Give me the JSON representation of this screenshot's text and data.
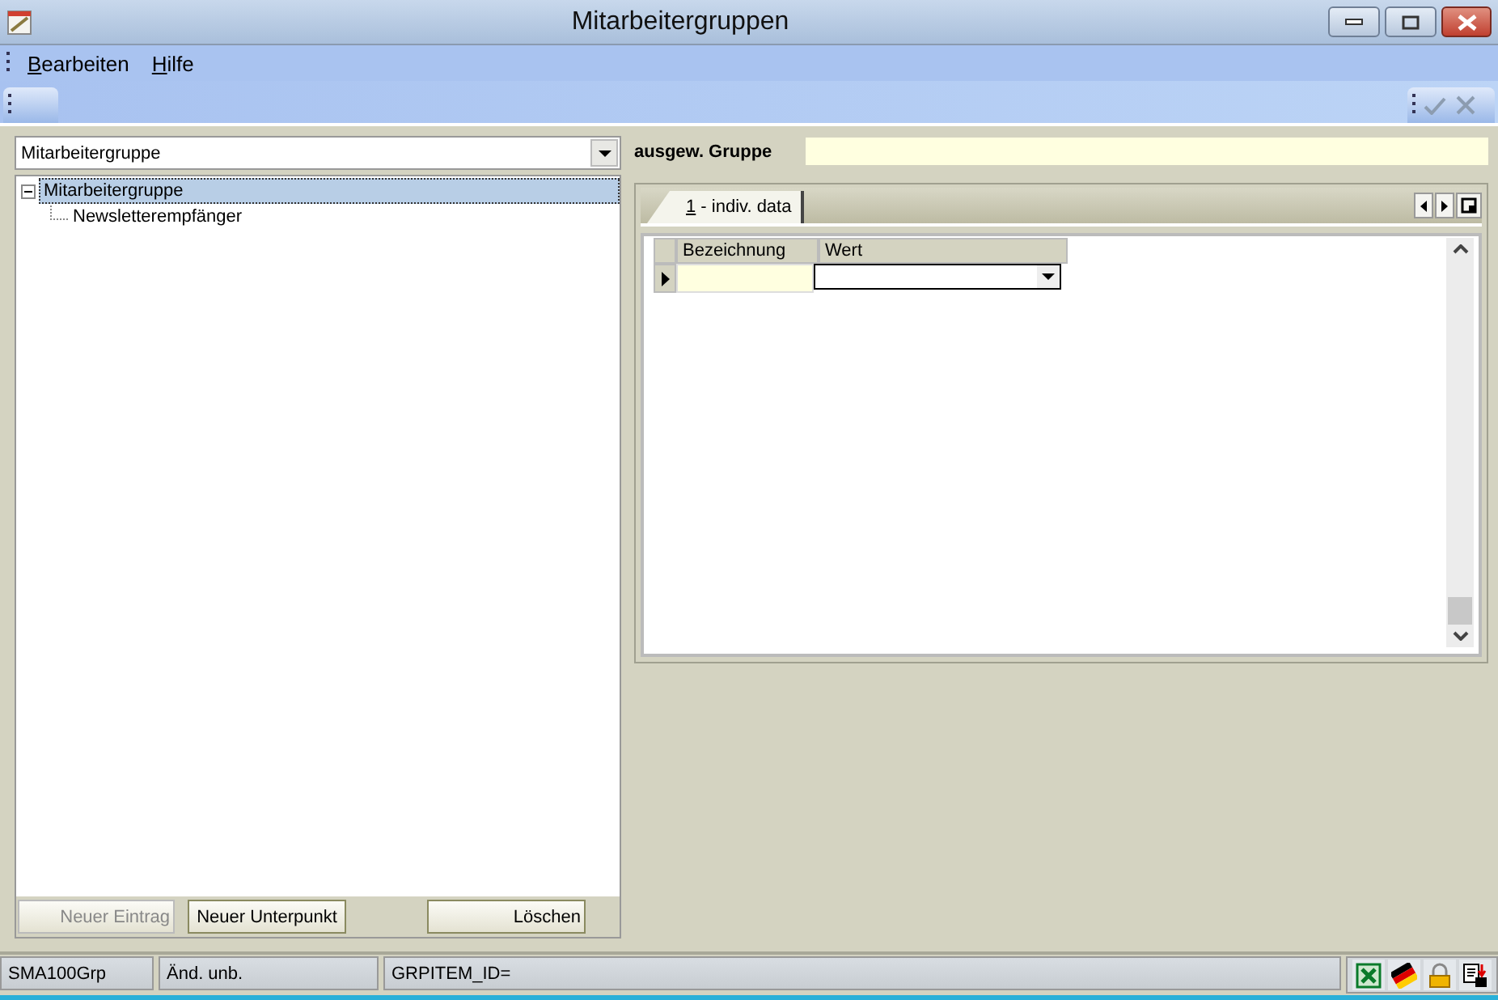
{
  "window": {
    "title": "Mitarbeitergruppen"
  },
  "menu": [
    {
      "label": "Bearbeiten",
      "underlined_initial": true
    },
    {
      "label": "Hilfe",
      "underlined_initial": true
    }
  ],
  "toolbar_right": {
    "confirm_disabled": true,
    "cancel_disabled": true
  },
  "group_select": {
    "value": "Mitarbeitergruppe"
  },
  "tree": [
    {
      "label": "Mitarbeitergruppe",
      "selected": true,
      "expanded": true,
      "children": [
        {
          "label": "Newsletterempfänger",
          "selected": false
        }
      ]
    }
  ],
  "tree_buttons": [
    {
      "label": "Neuer Eintrag",
      "disabled": true
    },
    {
      "label": "Neuer Unterpunkt",
      "disabled": false
    },
    {
      "label": "Löschen",
      "disabled": false
    }
  ],
  "selected_group": {
    "label": "ausgew. Gruppe"
  },
  "tabs": [
    {
      "label": "1 - indiv. data",
      "underlined_initial": true,
      "selected": true
    }
  ],
  "grid": {
    "columns": [
      "Bezeichnung",
      "Wert"
    ],
    "rows": [
      {
        "current": true,
        "cells": [
          "",
          ""
        ]
      }
    ]
  },
  "status_bar": [
    "SMA100Grp",
    "Änd. unb.",
    "GRPITEM_ID="
  ]
}
